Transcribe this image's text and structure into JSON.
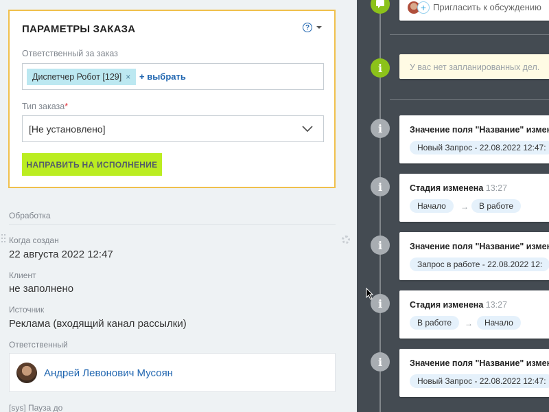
{
  "order_params": {
    "title": "ПАРАМЕТРЫ ЗАКАЗА",
    "help_icon": "question-circle-icon",
    "responsible_label": "Ответственный за заказ",
    "responsible_tag": "Диспетчер Робот [129]",
    "remove_symbol": "×",
    "choose_link": "+ выбрать",
    "type_label": "Тип заказа",
    "required_mark": "*",
    "type_value": "[Не установлено]",
    "execute_button": "НАПРАВИТЬ НА ИСПОЛНЕНИЕ"
  },
  "details": {
    "section_title": "Обработка",
    "created_label": "Когда создан",
    "created_value": "22 августа 2022 12:47",
    "client_label": "Клиент",
    "client_value": "не заполнено",
    "source_label": "Источник",
    "source_value": "Реклама (входящий канал рассылки)",
    "assignee_label": "Ответственный",
    "assignee_name": "Андрей Левонович Мусоян",
    "pause_label": "[sys] Пауза до"
  },
  "timeline": {
    "invite_text": "Пригласить к обсуждению",
    "no_plans_text": "У вас нет запланированных дел.",
    "info_glyph": "i",
    "arrow": "→",
    "events": [
      {
        "title": "Значение поля \"Название\" изменено",
        "time": "",
        "pill": "Новый Запрос - 22.08.2022 12:47:"
      },
      {
        "title": "Стадия изменена",
        "time": "13:27",
        "from": "Начало",
        "to": "В работе"
      },
      {
        "title": "Значение поля \"Название\" изменено",
        "time": "",
        "pill": "Запрос в работе - 22.08.2022 12:"
      },
      {
        "title": "Стадия изменена",
        "time": "13:27",
        "from": "В работе",
        "to": "Начало"
      },
      {
        "title": "Значение поля \"Название\" изменено",
        "time": "",
        "pill": "Новый Запрос - 22.08.2022 12:47:"
      }
    ]
  },
  "colors": {
    "accent_yellow": "#f0c04c",
    "button_green": "#bbed21",
    "link_blue": "#2066b0",
    "timeline_bg": "#444b52",
    "tag_bg": "#bce8f1"
  }
}
